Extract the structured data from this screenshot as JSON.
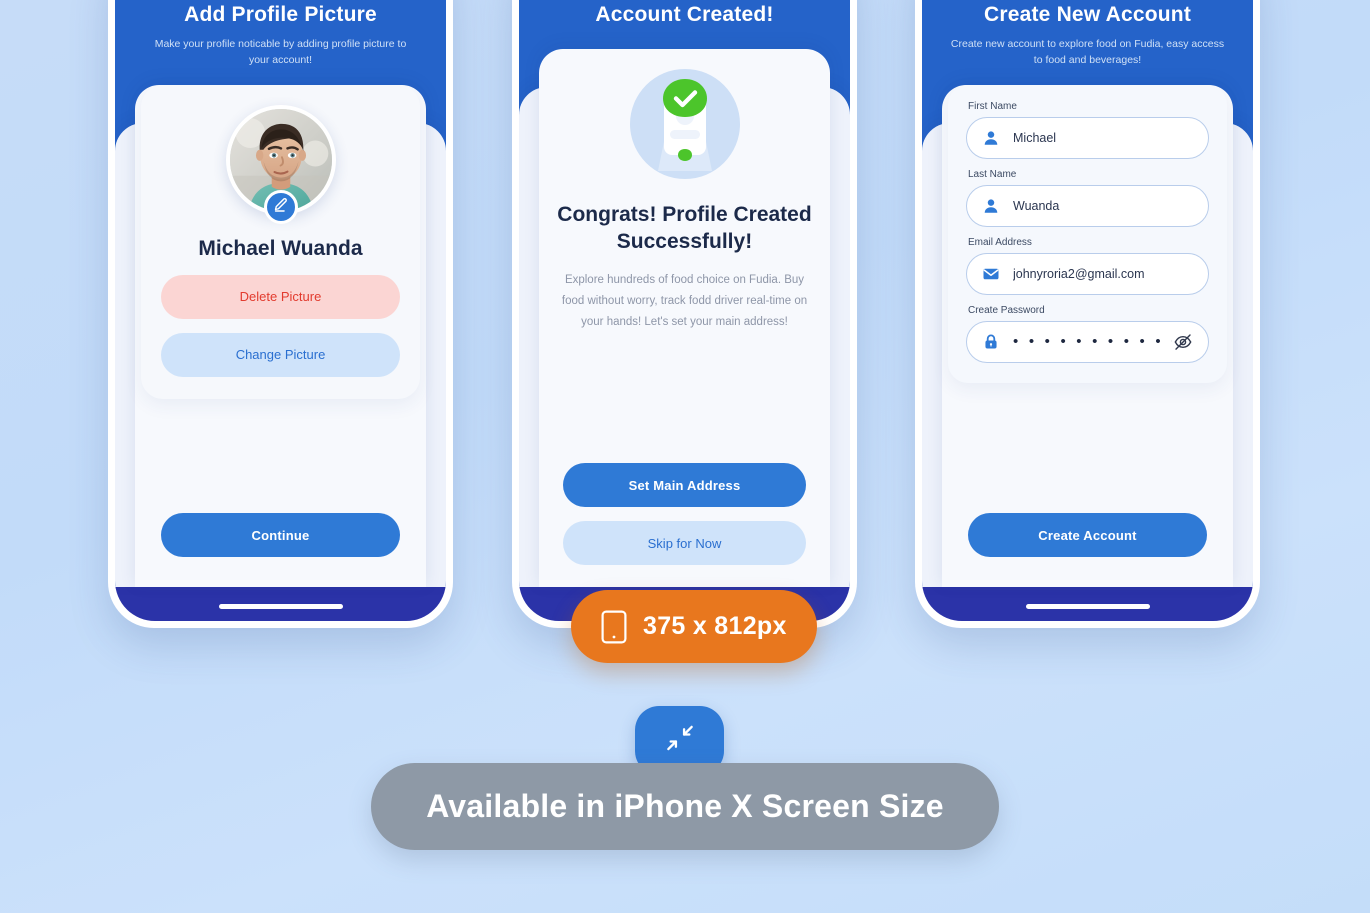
{
  "background": {
    "color": "#c4ddf9"
  },
  "phones": [
    {
      "id": "add-profile-picture",
      "title": "Add Profile Picture",
      "subtitle": "Make your profile noticable by adding profile picture to your account!",
      "person_name": "Michael Wuanda",
      "edit_icon": "pencil-icon",
      "avatar_icon": "user-photo",
      "buttons": {
        "delete": "Delete Picture",
        "change": "Change Picture",
        "continue": "Continue"
      }
    },
    {
      "id": "account-created",
      "title": "Account Created!",
      "illustration_icon": "id-card-check-icon",
      "heading": "Congrats! Profile Created Successfully!",
      "description": "Explore hundreds of food choice on Fudia. Buy food without worry, track fodd driver real-time on your hands! Let's set your main address!",
      "buttons": {
        "primary": "Set Main Address",
        "secondary": "Skip for Now"
      }
    },
    {
      "id": "create-new-account",
      "title": "Create New Account",
      "subtitle": "Create new account to explore food on Fudia, easy access to food and beverages!",
      "fields": [
        {
          "label": "First Name",
          "value": "Michael",
          "icon": "person-icon",
          "type": "text"
        },
        {
          "label": "Last Name",
          "value": "Wuanda",
          "icon": "person-icon",
          "type": "text"
        },
        {
          "label": "Email Address",
          "value": "johnyroria2@gmail.com",
          "icon": "envelope-icon",
          "type": "email"
        },
        {
          "label": "Create Password",
          "value": "• • • • • • • • • • • • • •",
          "icon": "lock-icon",
          "type": "password",
          "toggle_icon": "eye-off-icon"
        }
      ],
      "buttons": {
        "submit": "Create Account"
      }
    }
  ],
  "size_badge": {
    "icon": "mobile-icon",
    "label": "375 x 812px",
    "color": "#e8771e"
  },
  "shrink_fab": {
    "icon": "shrink-arrows-icon",
    "color": "#2f7ad6"
  },
  "availability": {
    "label": "Available in iPhone X Screen Size",
    "color": "#8e99a6"
  }
}
